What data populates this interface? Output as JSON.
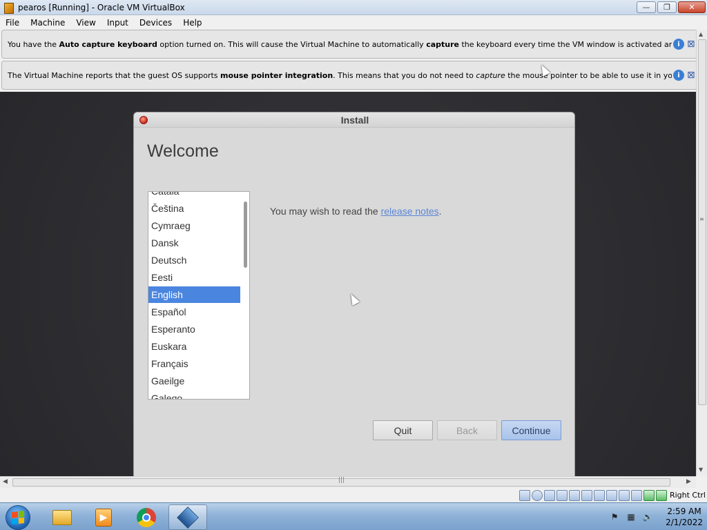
{
  "window": {
    "title": "pearos [Running] - Oracle VM VirtualBox",
    "minimize_label": "—",
    "restore_label": "❐",
    "close_label": "✕"
  },
  "menubar": {
    "items": [
      "File",
      "Machine",
      "View",
      "Input",
      "Devices",
      "Help"
    ]
  },
  "notices": [
    {
      "parts": [
        "You have the ",
        "Auto capture keyboard",
        " option turned on. This will cause the Virtual Machine to automatically ",
        "capture",
        " the keyboard every time the VM window is activated and make it unavailable to"
      ]
    },
    {
      "parts": [
        "The Virtual Machine reports that the guest OS supports ",
        "mouse pointer integration",
        ". This means that you do not need to ",
        "capture",
        " the mouse pointer to be able to use it in your guest OS -- all mouse"
      ]
    }
  ],
  "installer": {
    "title": "Install",
    "heading": "Welcome",
    "languages": [
      "Català",
      "Čeština",
      "Cymraeg",
      "Dansk",
      "Deutsch",
      "Eesti",
      "English",
      "Español",
      "Esperanto",
      "Euskara",
      "Français",
      "Gaeilge",
      "Galego"
    ],
    "selected_language": "English",
    "release_prefix": "You may wish to read the ",
    "release_link": "release notes",
    "release_suffix": ".",
    "buttons": {
      "quit": "Quit",
      "back": "Back",
      "continue": "Continue"
    }
  },
  "statusbar": {
    "host_key": "Right Ctrl"
  },
  "taskbar": {
    "clock_time": "2:59 AM",
    "clock_date": "2/1/2022"
  }
}
